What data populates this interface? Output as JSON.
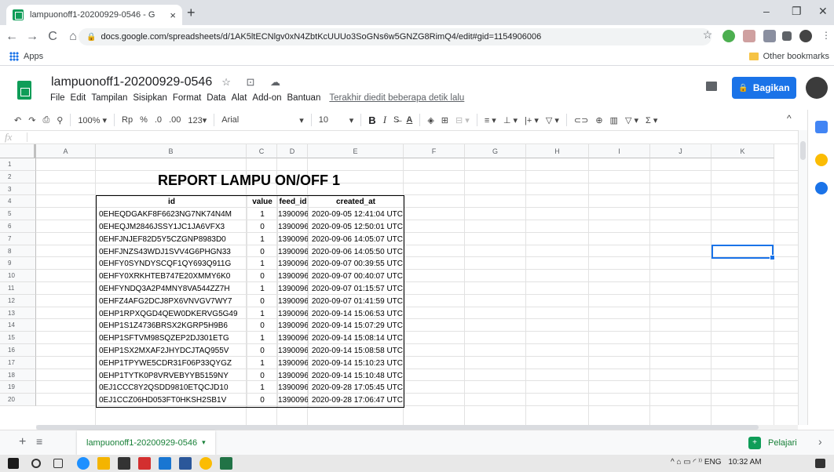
{
  "browser": {
    "tab_title": "lampuonoff1-20200929-0546 - G",
    "tab_close": "×",
    "new_tab": "+",
    "url": "docs.google.com/spreadsheets/d/1AK5ltECNlgv0xN4ZbtKcUUUo3SoGNs6w5GNZG8RimQ4/edit#gid=1154906006",
    "apps_label": "Apps",
    "other_bookmarks": "Other bookmarks",
    "win_minimize": "–",
    "win_restore": "❐",
    "win_close": "✕",
    "back": "←",
    "forward": "→",
    "reload": "C",
    "home": "⌂",
    "star": "☆"
  },
  "sheet": {
    "title": "lampuonoff1-20200929-0546",
    "title_icons": "☆ ⊡ ☁",
    "menu": [
      "File",
      "Edit",
      "Tampilan",
      "Sisipkan",
      "Format",
      "Data",
      "Alat",
      "Add-on",
      "Bantuan"
    ],
    "last_edit": "Terakhir diedit beberapa detik lalu",
    "share_label": "Bagikan",
    "share_icon": "🔒"
  },
  "toolbar": {
    "undo": "↶",
    "redo": "↷",
    "print": "⎙",
    "paint": "⚲",
    "zoom": "100% ▾",
    "currency": "Rp",
    "percent": "%",
    "dec_less": ".0",
    "dec_more": ".00",
    "number_format": "123▾",
    "font": "Arial",
    "font_caret": "▾",
    "font_size": "10",
    "size_caret": "▾",
    "bold": "B",
    "italic": "I",
    "strike": "S̶",
    "text_color": "A",
    "fill": "◈",
    "borders": "⊞",
    "merge": "⊟ ▾",
    "halign": "≡ ▾",
    "valign": "⊥ ▾",
    "wrap": "|+ ▾",
    "rotate": "▽ ▾",
    "link": "⊂⊃",
    "comment": "⊕",
    "chart": "▥",
    "filter": "▽ ▾",
    "functions": "Σ ▾",
    "collapse": "^",
    "fx": "fx"
  },
  "grid": {
    "columns": [
      "A",
      "B",
      "C",
      "D",
      "E",
      "F",
      "G",
      "H",
      "I",
      "J",
      "K"
    ],
    "rows": [
      "1",
      "2",
      "3",
      "4",
      "5",
      "6",
      "7",
      "8",
      "9",
      "10",
      "11",
      "12",
      "13",
      "14",
      "15",
      "16",
      "17",
      "18",
      "19",
      "20"
    ],
    "report_title": "REPORT LAMPU ON/OFF 1",
    "headers": [
      "id",
      "value",
      "feed_id",
      "created_at"
    ],
    "data": [
      [
        "0EHEQDGAKF8F6623NG7NK74N4M",
        "1",
        "1390096",
        "2020-09-05 12:41:04 UTC"
      ],
      [
        "0EHEQJM2846JSSY1JC1JA6VFX3",
        "0",
        "1390096",
        "2020-09-05 12:50:01 UTC"
      ],
      [
        "0EHFJNJEF82D5Y5CZGNP8983D0",
        "1",
        "1390096",
        "2020-09-06 14:05:07 UTC"
      ],
      [
        "0EHFJNZS43WDJ1SVV4G6PHGN33",
        "0",
        "1390096",
        "2020-09-06 14:05:50 UTC"
      ],
      [
        "0EHFY0SYNDYSCQF1QY693Q911G",
        "1",
        "1390096",
        "2020-09-07 00:39:55 UTC"
      ],
      [
        "0EHFY0XRKHTEB747E20XMMY6K0",
        "0",
        "1390096",
        "2020-09-07 00:40:07 UTC"
      ],
      [
        "0EHFYNDQ3A2P4MNY8VA544ZZ7H",
        "1",
        "1390096",
        "2020-09-07 01:15:57 UTC"
      ],
      [
        "0EHFZ4AFG2DCJ8PX6VNVGV7WY7",
        "0",
        "1390096",
        "2020-09-07 01:41:59 UTC"
      ],
      [
        "0EHP1RPXQGD4QEW0DKERVG5G49",
        "1",
        "1390096",
        "2020-09-14 15:06:53 UTC"
      ],
      [
        "0EHP1S1Z4736BRSX2KGRP5H9B6",
        "0",
        "1390096",
        "2020-09-14 15:07:29 UTC"
      ],
      [
        "0EHP1SFTVM98SQZEP2DJ301ETG",
        "1",
        "1390096",
        "2020-09-14 15:08:14 UTC"
      ],
      [
        "0EHP1SX2MXAF2JHYDCJTAQ955V",
        "0",
        "1390096",
        "2020-09-14 15:08:58 UTC"
      ],
      [
        "0EHP1TPYWE5CDR31F06P33QYGZ",
        "1",
        "1390096",
        "2020-09-14 15:10:23 UTC"
      ],
      [
        "0EHP1TYTK0P8VRVEBYYB5159NY",
        "0",
        "1390096",
        "2020-09-14 15:10:48 UTC"
      ],
      [
        "0EJ1CCC8Y2QSDD9810ETQCJD10",
        "1",
        "1390096",
        "2020-09-28 17:05:45 UTC"
      ],
      [
        "0EJ1CCZ06HD053FT0HKSH2SB1V",
        "0",
        "1390096",
        "2020-09-28 17:06:47 UTC"
      ]
    ]
  },
  "sheettabs": {
    "add": "+",
    "all": "≡",
    "active_tab": "lampuonoff1-20200929-0546",
    "tab_caret": "▾",
    "explore_label": "Pelajari",
    "explore_icon": "+",
    "next": "›"
  },
  "taskbar": {
    "tray_text": "^ ⌂ ▭ ◜ ⁾⁾ ENG",
    "clock": "10:32 AM"
  },
  "colors": {
    "accent": "#1a73e8",
    "sheets_green": "#0f9d58",
    "tab_green": "#188038"
  }
}
